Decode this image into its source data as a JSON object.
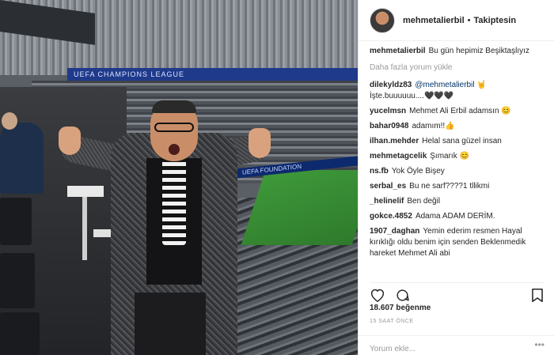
{
  "photo": {
    "adboard_text": "UEFA CHAMPIONS LEAGUE",
    "adboard2_text": "UEFA FOUNDATION"
  },
  "post": {
    "username": "mehmetalierbil",
    "follow_status": "Takiptesin",
    "caption_user": "mehmetalierbil",
    "caption_text": "Bu gün hepimiz Beşiktaşlıyız",
    "load_more": "Daha fazla yorum yükle",
    "comments": [
      {
        "user": "dilekyldz83",
        "mention": "@mehmetalierbil",
        "text": "🤘 İşte.buuuuuu....🖤🖤🖤"
      },
      {
        "user": "yucelmsn",
        "mention": "",
        "text": "Mehmet Ali Erbil adamsın 😊"
      },
      {
        "user": "bahar0948",
        "mention": "",
        "text": "adamım!!👍"
      },
      {
        "user": "ilhan.mehder",
        "mention": "",
        "text": "Helal sana güzel insan"
      },
      {
        "user": "mehmetagcelik",
        "mention": "",
        "text": "Şımarık 😊"
      },
      {
        "user": "ns.fb",
        "mention": "",
        "text": "Yok Öyle Bişey"
      },
      {
        "user": "serbal_es",
        "mention": "",
        "text": "Bu ne sarf????1 tllikmi"
      },
      {
        "user": "_helinelif",
        "mention": "",
        "text": "Ben değil"
      },
      {
        "user": "gokce.4852",
        "mention": "",
        "text": "Adama ADAM DERİM."
      },
      {
        "user": "1907_daghan",
        "mention": "",
        "text": "Yemin ederim resmen Hayal kırıklığı oldu benim için senden Beklenmedik hareket Mehmet Ali abi"
      }
    ],
    "likes": "18.607 beğenme",
    "time": "15 SAAT ÖNCE",
    "comment_placeholder": "Yorum ekle...",
    "more_options": "•••"
  },
  "icons": {
    "like": "heart-icon",
    "comment": "comment-icon",
    "save": "bookmark-icon"
  }
}
